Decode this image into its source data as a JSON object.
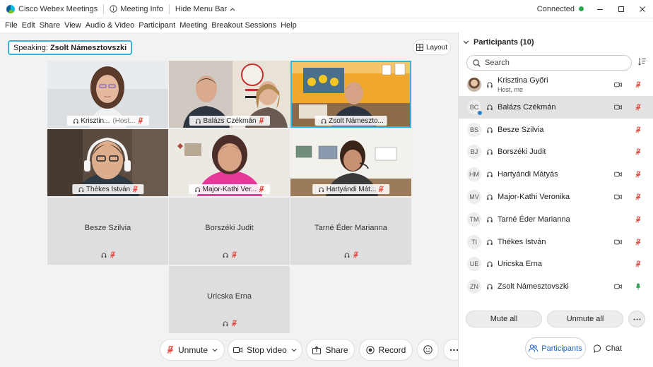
{
  "titlebar": {
    "app_name": "Cisco Webex Meetings",
    "meeting_info": "Meeting Info",
    "hide_menu": "Hide Menu Bar",
    "status": "Connected"
  },
  "menu": [
    "File",
    "Edit",
    "Share",
    "View",
    "Audio & Video",
    "Participant",
    "Meeting",
    "Breakout Sessions",
    "Help"
  ],
  "stage": {
    "speaking_label": "Speaking:",
    "speaking_name": "Zsolt Námesztovszki",
    "layout_label": "Layout"
  },
  "tiles": [
    {
      "name": "Krisztin...",
      "tag": "(Host..."
    },
    {
      "name": "Balázs Czékmán"
    },
    {
      "name": "Zsolt Námeszto..."
    },
    {
      "name": "Thékes István"
    },
    {
      "name": "Major-Kathi Ver..."
    },
    {
      "name": "Hartyándi Mát..."
    }
  ],
  "audio_only_tiles": [
    "Besze Szilvia",
    "Borszéki Judit",
    "Tarné Éder Marianna",
    "Uricska Erna"
  ],
  "controls": {
    "unmute": "Unmute",
    "stop_video": "Stop video",
    "share": "Share",
    "record": "Record"
  },
  "panel": {
    "title": "Participants (10)",
    "search_placeholder": "Search",
    "mute_all": "Mute all",
    "unmute_all": "Unmute all",
    "tab_participants": "Participants",
    "tab_chat": "Chat"
  },
  "participants": [
    {
      "initials": "",
      "name": "Krisztina Győri",
      "sub": "Host, me",
      "video": true,
      "muted": true
    },
    {
      "initials": "BC",
      "name": "Balázs Czékmán",
      "sub": "",
      "video": true,
      "muted": true
    },
    {
      "initials": "BS",
      "name": "Besze Szilvia",
      "sub": "",
      "video": false,
      "muted": true
    },
    {
      "initials": "BJ",
      "name": "Borszéki Judit",
      "sub": "",
      "video": false,
      "muted": true
    },
    {
      "initials": "HM",
      "name": "Hartyándi Mátyás",
      "sub": "",
      "video": true,
      "muted": true
    },
    {
      "initials": "MV",
      "name": "Major-Kathi Veronika",
      "sub": "",
      "video": true,
      "muted": true
    },
    {
      "initials": "TM",
      "name": "Tarné Éder Marianna",
      "sub": "",
      "video": false,
      "muted": true
    },
    {
      "initials": "TI",
      "name": "Thékes István",
      "sub": "",
      "video": true,
      "muted": true
    },
    {
      "initials": "UE",
      "name": "Uricska Erna",
      "sub": "",
      "video": false,
      "muted": true
    },
    {
      "initials": "ZN",
      "name": "Zsolt Námesztovszki",
      "sub": "",
      "video": true,
      "muted": false
    }
  ],
  "colors": {
    "accent": "#1a61c7",
    "end_call": "#e5372d",
    "muted": "#e0463c",
    "active_speaker": "#29b6e8",
    "unmuted": "#2fa84f"
  }
}
